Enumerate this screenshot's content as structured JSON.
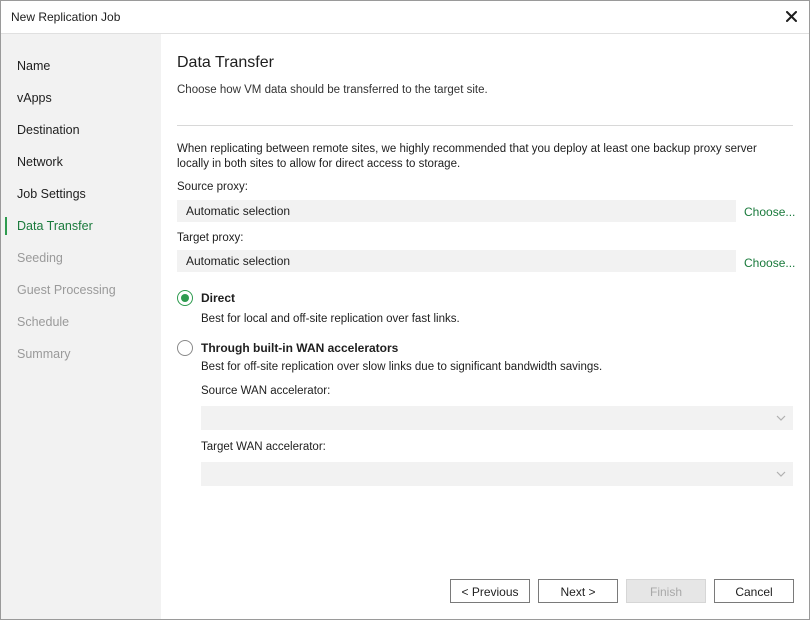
{
  "window": {
    "title": "New Replication Job",
    "close_icon": "close-icon"
  },
  "sidebar": {
    "items": [
      {
        "label": "Name",
        "state": "done"
      },
      {
        "label": "vApps",
        "state": "done"
      },
      {
        "label": "Destination",
        "state": "done"
      },
      {
        "label": "Network",
        "state": "done"
      },
      {
        "label": "Job Settings",
        "state": "done"
      },
      {
        "label": "Data Transfer",
        "state": "active"
      },
      {
        "label": "Seeding",
        "state": "disabled"
      },
      {
        "label": "Guest Processing",
        "state": "disabled"
      },
      {
        "label": "Schedule",
        "state": "disabled"
      },
      {
        "label": "Summary",
        "state": "disabled"
      }
    ]
  },
  "main": {
    "title": "Data Transfer",
    "description": "Choose how VM data should be transferred to the target site.",
    "info": "When replicating between remote sites, we highly recommended that you deploy at least one backup proxy server locally in both sites to allow for direct access to storage.",
    "source_proxy": {
      "label": "Source proxy:",
      "value": "Automatic selection",
      "choose_label": "Choose..."
    },
    "target_proxy": {
      "label": "Target proxy:",
      "value": "Automatic selection",
      "choose_label": "Choose..."
    },
    "options": {
      "direct": {
        "label": "Direct",
        "description": "Best for local and off-site replication over fast links.",
        "selected": true
      },
      "wan": {
        "label": "Through built-in WAN accelerators",
        "description": "Best for off-site replication over slow links due to significant bandwidth savings.",
        "selected": false,
        "source_label": "Source WAN accelerator:",
        "source_value": "",
        "target_label": "Target WAN accelerator:",
        "target_value": ""
      }
    }
  },
  "buttons": {
    "previous": "< Previous",
    "next": "Next >",
    "finish": "Finish",
    "cancel": "Cancel"
  },
  "colors": {
    "accent": "#2e9b4f",
    "link": "#1a7a3c",
    "sidebar_bg": "#f2f2f2",
    "field_bg": "#f2f2f2",
    "disabled_text": "#9a9a9a"
  }
}
